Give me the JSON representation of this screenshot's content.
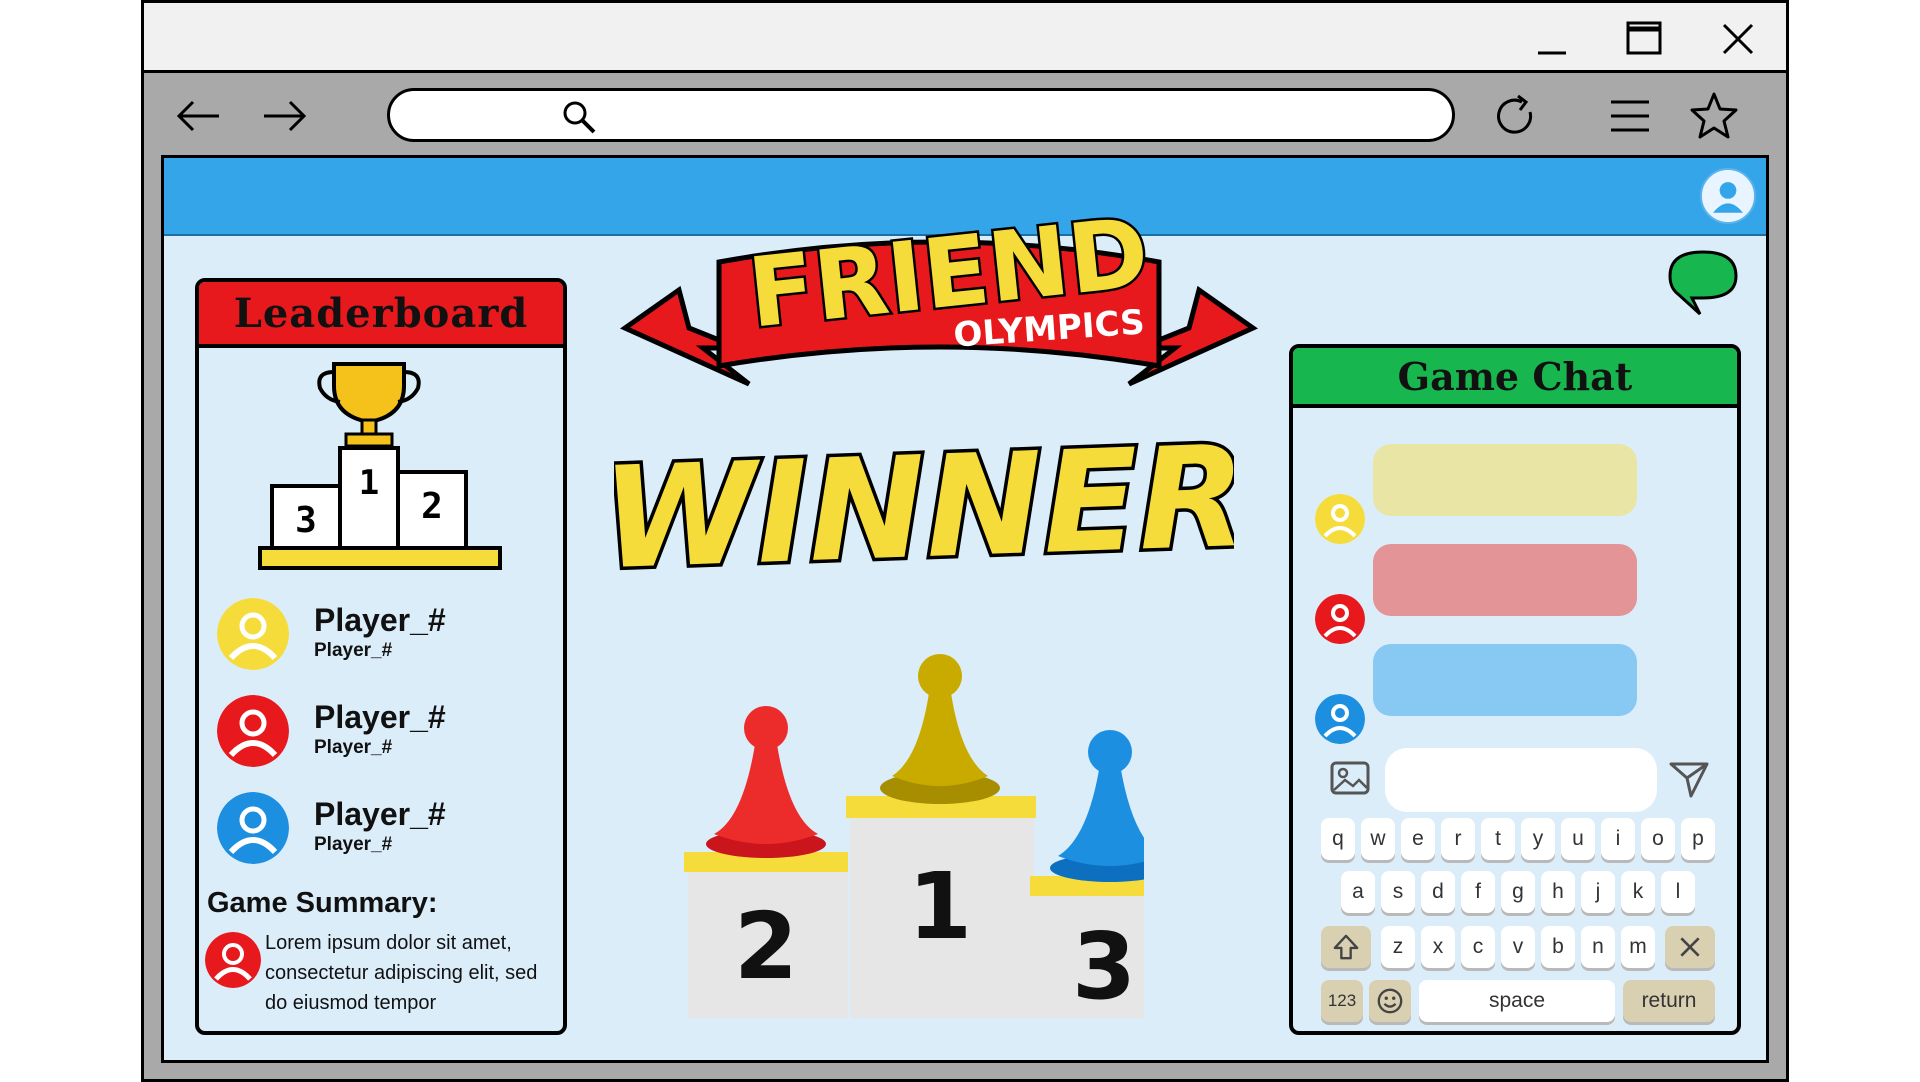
{
  "browser": {
    "title_buttons": [
      "minimize-icon",
      "maximize-icon",
      "close-icon"
    ],
    "nav_icons": [
      "back-arrow-icon",
      "forward-arrow-icon",
      "reload-icon",
      "menu-icon",
      "star-icon"
    ],
    "address_value": ""
  },
  "banner": {
    "title": "FRIEND",
    "subtitle": "OLYMPICS"
  },
  "winner_text": "WINNER",
  "podium": {
    "places": [
      "2",
      "1",
      "3"
    ]
  },
  "leaderboard": {
    "title": "Leaderboard",
    "icon_places": [
      "3",
      "1",
      "2"
    ],
    "players": [
      {
        "name": "Player_#",
        "sub": "Player_#",
        "color": "#f6dc3a"
      },
      {
        "name": "Player_#",
        "sub": "Player_#",
        "color": "#e8191d"
      },
      {
        "name": "Player_#",
        "sub": "Player_#",
        "color": "#1d8fe1"
      }
    ],
    "summary_title": "Game Summary:",
    "summary_text": "Lorem ipsum dolor sit amet, consectetur adipiscing elit, sed do eiusmod tempor"
  },
  "chat": {
    "title": "Game Chat",
    "messages": [
      {
        "color": "#e9e5a4",
        "avatar": "#f6dc3a"
      },
      {
        "color": "#e39496",
        "avatar": "#e8191d"
      },
      {
        "color": "#87c9f2",
        "avatar": "#1d8fe1"
      }
    ],
    "input_value": "",
    "keyboard": {
      "row1": [
        "q",
        "w",
        "e",
        "r",
        "t",
        "y",
        "u",
        "i",
        "o",
        "p"
      ],
      "row2": [
        "a",
        "s",
        "d",
        "f",
        "g",
        "h",
        "j",
        "k",
        "l"
      ],
      "row3": [
        "z",
        "x",
        "c",
        "v",
        "b",
        "n",
        "m"
      ],
      "numbers_key": "123",
      "space_key": "space",
      "return_key": "return"
    }
  },
  "colors": {
    "top_band": "#35a5ea",
    "leader_header": "#e8191d",
    "chat_header": "#18b64e",
    "background": "#dcedfa"
  }
}
